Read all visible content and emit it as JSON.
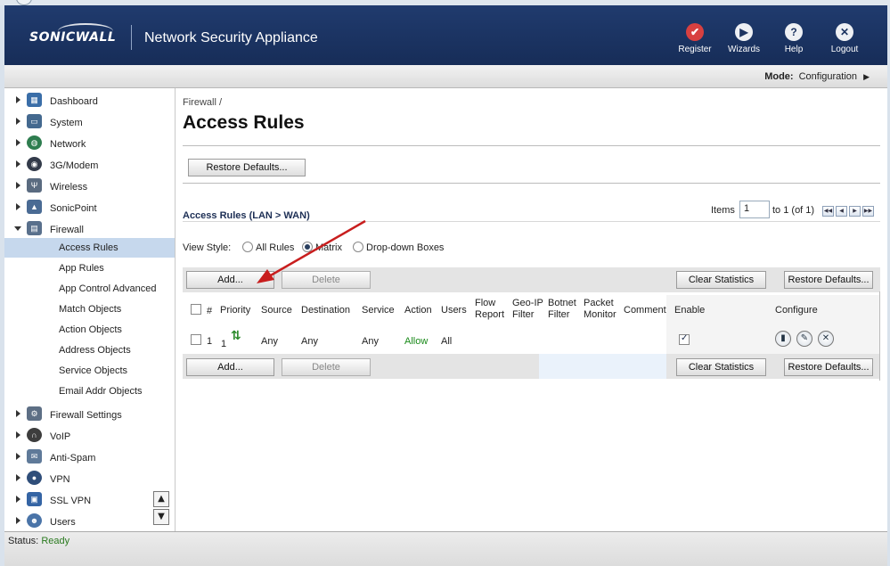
{
  "header": {
    "logo": "SONICWALL",
    "app_title": "Network Security Appliance",
    "buttons": [
      {
        "label": "Register",
        "icon": "check-icon"
      },
      {
        "label": "Wizards",
        "icon": "play-icon"
      },
      {
        "label": "Help",
        "icon": "question-icon"
      },
      {
        "label": "Logout",
        "icon": "close-icon"
      }
    ]
  },
  "modebar": {
    "mode_label": "Mode:",
    "mode_value": "Configuration"
  },
  "sidebar": {
    "items": [
      {
        "label": "Dashboard",
        "icon": "dashboard-icon",
        "color": "#3a6ea8"
      },
      {
        "label": "System",
        "icon": "monitor-icon",
        "color": "#44698f"
      },
      {
        "label": "Network",
        "icon": "globe-icon",
        "color": "#2e7d4f"
      },
      {
        "label": "3G/Modem",
        "icon": "modem-icon",
        "color": "#333b4a"
      },
      {
        "label": "Wireless",
        "icon": "antenna-icon",
        "color": "#5a6b80"
      },
      {
        "label": "SonicPoint",
        "icon": "access-point-icon",
        "color": "#4a6b94"
      },
      {
        "label": "Firewall",
        "icon": "firewall-icon",
        "color": "#59708c"
      }
    ],
    "firewall_sub": [
      "Access Rules",
      "App Rules",
      "App Control Advanced",
      "Match Objects",
      "Action Objects",
      "Address Objects",
      "Service Objects",
      "Email Addr Objects"
    ],
    "items_after": [
      {
        "label": "Firewall Settings",
        "icon": "gear-icon",
        "color": "#5d6f85"
      },
      {
        "label": "VoIP",
        "icon": "headset-icon",
        "color": "#3d3d3d"
      },
      {
        "label": "Anti-Spam",
        "icon": "envelope-icon",
        "color": "#5f7a99"
      },
      {
        "label": "VPN",
        "icon": "lock-icon",
        "color": "#2f4e7a"
      },
      {
        "label": "SSL VPN",
        "icon": "network-icon",
        "color": "#3464a4"
      },
      {
        "label": "Users",
        "icon": "users-icon",
        "color": "#4a74a8"
      }
    ]
  },
  "main": {
    "breadcrumb": "Firewall /",
    "title": "Access Rules",
    "restore_defaults_top": "Restore Defaults...",
    "section_title": "Access Rules (LAN > WAN)",
    "pager": {
      "items_label": "Items",
      "page_value": "1",
      "range": "to 1 (of 1)"
    },
    "view_style": {
      "label": "View Style:",
      "options": [
        "All Rules",
        "Matrix",
        "Drop-down Boxes"
      ],
      "selected": "Matrix"
    },
    "toolbar": {
      "add": "Add...",
      "delete": "Delete",
      "clear_stats": "Clear Statistics",
      "restore_defaults": "Restore Defaults..."
    },
    "columns": {
      "num": "#",
      "priority": "Priority",
      "source": "Source",
      "destination": "Destination",
      "service": "Service",
      "action": "Action",
      "users": "Users",
      "flow_report": [
        "Flow",
        "Report"
      ],
      "geo_ip": [
        "Geo-IP",
        "Filter"
      ],
      "botnet": [
        "Botnet",
        "Filter"
      ],
      "packet_monitor": [
        "Packet",
        "Monitor"
      ],
      "comment": "Comment",
      "enable": "Enable",
      "configure": "Configure"
    },
    "rows": [
      {
        "num": "1",
        "priority": "1",
        "source": "Any",
        "destination": "Any",
        "service": "Any",
        "action": "Allow",
        "users": "All",
        "enabled": true
      }
    ],
    "action_color": "#1a8a1a"
  },
  "status": {
    "label": "Status:",
    "value": "Ready"
  }
}
